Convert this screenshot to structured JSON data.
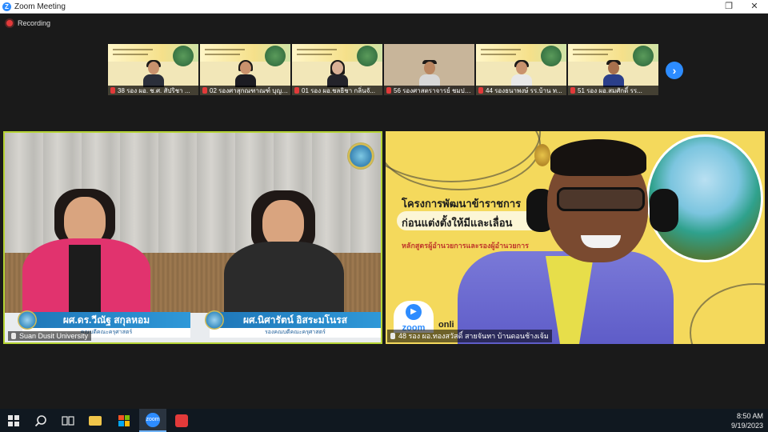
{
  "window": {
    "title": "Zoom Meeting",
    "logo_letter": "Z",
    "controls": [
      "❐",
      "✕"
    ]
  },
  "recording": {
    "label": "Recording"
  },
  "thumbnails": [
    {
      "name": "38 รอง ผอ. ช.ศ. สัปริชา ..."
    },
    {
      "name": "02 รองศาสุกณฑาณฑ์ บุญลั..."
    },
    {
      "name": "01 รอง ผอ.ชลธิชา กลิ่นจั..."
    },
    {
      "name": "56 รองศาสตราจารย์ ชมประชา..."
    },
    {
      "name": "44 รองธนาพงษ์ รร.บ้าน ท..."
    },
    {
      "name": "51 รอง ผอ.สมศักดิ์ รร..."
    }
  ],
  "next_button": "›",
  "left_tile": {
    "nameplate_left": {
      "name": "ผศ.ดร.วีณัฐ สกุลหอม",
      "title": "คณบดีคณะครุศาสตร์"
    },
    "nameplate_right": {
      "name": "ผศ.นิศารัตน์ อิสระมโนรส",
      "title": "รองคณบดีคณะครุศาสตร์"
    },
    "label": "Suan Dusit University"
  },
  "right_tile": {
    "slide_line1": "โครงการพัฒนาข้าราชการ",
    "slide_line2": "ก่อนแต่งตั้งให้มีและเลื่อน",
    "slide_sub": "หลักสูตรผู้อำนวยการและรองผู้อำนวยการ",
    "zoom_text": "zoom",
    "online_text": "onli",
    "label": "48 รอง ผอ.ทองสวัสดิ์ สายจันทา บ้านดอนช้างเจ้ม"
  },
  "taskbar": {
    "zoom_label": "zoom",
    "time": "8:50 AM",
    "date": "9/19/2023"
  }
}
